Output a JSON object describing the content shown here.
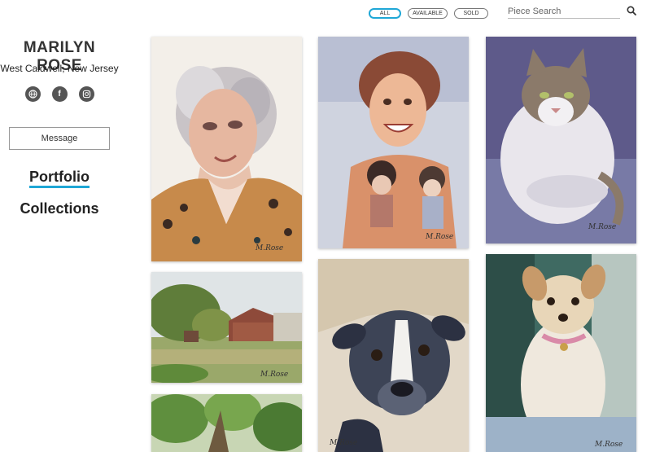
{
  "artist": {
    "name": "MARILYN ROSE",
    "location": "West Caldwell, New Jersey"
  },
  "socials": [
    {
      "name": "website",
      "icon": "globe-icon"
    },
    {
      "name": "facebook",
      "icon": "facebook-icon",
      "glyph": "f"
    },
    {
      "name": "instagram",
      "icon": "instagram-icon"
    }
  ],
  "message_label": "Message",
  "nav": {
    "portfolio": "Portfolio",
    "collections": "Collections"
  },
  "filters": {
    "all": "ALL",
    "available": "AVAILABLE",
    "sold": "SOLD",
    "active": "all"
  },
  "search": {
    "placeholder": "Piece Search",
    "value": ""
  },
  "colors": {
    "accent": "#1fa7d6",
    "text": "#222222"
  },
  "gallery": [
    {
      "subject": "portrait of elderly woman in leopard print"
    },
    {
      "subject": "smiling girl holding dolls"
    },
    {
      "subject": "long-haired cat"
    },
    {
      "subject": "landscape with red barn"
    },
    {
      "subject": "black and white pit bull"
    },
    {
      "subject": "small tan dog with pink collar"
    },
    {
      "subject": "green foliage landscape"
    }
  ]
}
